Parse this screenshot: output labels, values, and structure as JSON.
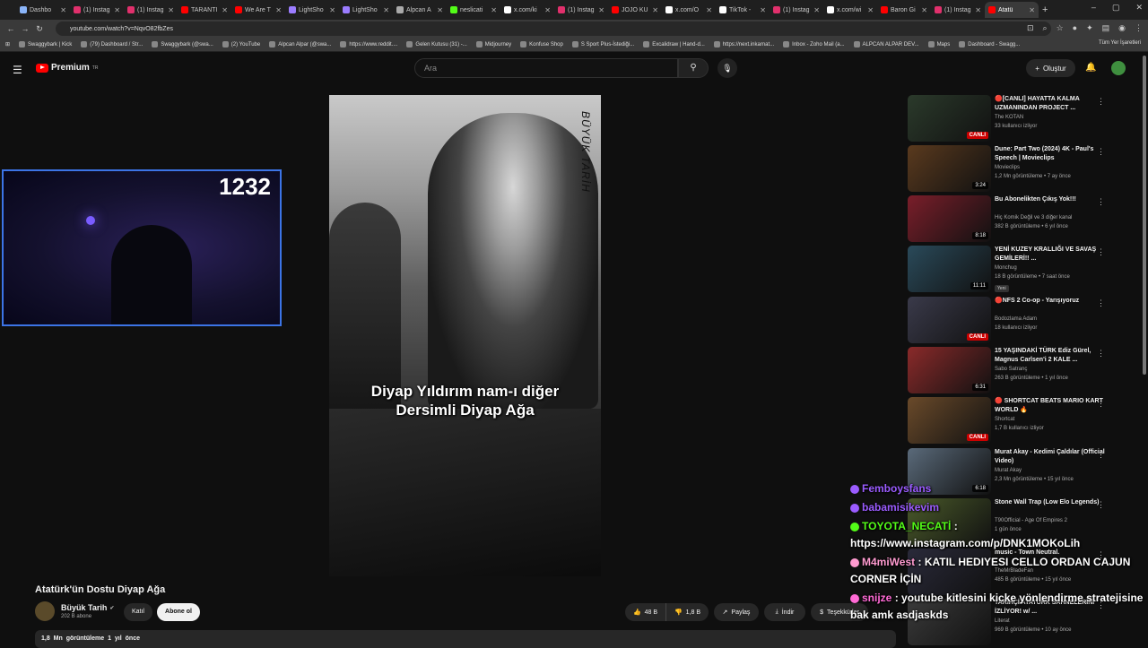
{
  "browser": {
    "tabs": [
      {
        "label": "Dashbo",
        "color": "#8ab4f8"
      },
      {
        "label": "(1) Instag",
        "color": "#e1306c"
      },
      {
        "label": "(1) Instag",
        "color": "#e1306c"
      },
      {
        "label": "TARANTI",
        "color": "#ff0000"
      },
      {
        "label": "We Are T",
        "color": "#ff0000"
      },
      {
        "label": "LightSho",
        "color": "#9b7cff"
      },
      {
        "label": "LightSho",
        "color": "#9b7cff"
      },
      {
        "label": "Alpcan A",
        "color": "#aaaaaa"
      },
      {
        "label": "neslicati",
        "color": "#53fc18"
      },
      {
        "label": "x.com/ki",
        "color": "#ffffff"
      },
      {
        "label": "(1) Instag",
        "color": "#e1306c"
      },
      {
        "label": "JOJO KU",
        "color": "#ff0000"
      },
      {
        "label": "x.com/O",
        "color": "#ffffff"
      },
      {
        "label": "TikTok - ",
        "color": "#ffffff"
      },
      {
        "label": "(1) Instag",
        "color": "#e1306c"
      },
      {
        "label": "x.com/wi",
        "color": "#ffffff"
      },
      {
        "label": "Baron Gi",
        "color": "#ff0000"
      },
      {
        "label": "(1) Instag",
        "color": "#e1306c"
      },
      {
        "label": "Atatü",
        "color": "#ff0000"
      }
    ],
    "url": "youtube.com/watch?v=NqvO82fbZes",
    "bookmarks": [
      "Swaggybark | Kick",
      "(79) Dashboard / Str...",
      "Swaggybark (@swa...",
      "(2) YouTube",
      "Alpcan Alpar (@swa...",
      "https://www.reddit....",
      "Gelen Kutusu (31) -...",
      "Midjourney",
      "Konfuse Shop",
      "S Sport Plus-İstediği...",
      "Excalidraw | Hand-d...",
      "https://next.inkarnat...",
      "Inbox - Zoho Mail (a...",
      "ALPCAN ALPAR DEV...",
      "Maps",
      "Dashboard - Swagg..."
    ],
    "all_bookmarks": "Tüm Yer İşaretleri"
  },
  "header": {
    "logo": "Premium",
    "logo_sup": "TR",
    "search_placeholder": "Ara",
    "create": "Oluştur"
  },
  "video": {
    "watermark": "BÜYÜK TARİH",
    "caption_line1": "Diyap Yıldırım nam-ı diğer",
    "caption_line2": "Dersimli Diyap Ağa",
    "title": "Atatürk'ün Dostu Diyap Ağa",
    "channel": "Büyük Tarih",
    "subs": "202 B abone",
    "join": "Katıl",
    "subscribe": "Abone ol",
    "likes": "48 B",
    "dislikes": "1,8 B",
    "share": "Paylaş",
    "download": "İndir",
    "thanks": "Teşekkürler",
    "views": "1,8 Mn görüntüleme",
    "age": "1 yıl önce"
  },
  "cam": {
    "counter": "1232"
  },
  "recs": [
    {
      "title": "🔴[CANLI] HAYATTA KALMA UZMANINDAN PROJECT ...",
      "channel": "The KOTAN",
      "meta": "33 kullanıcı izliyor",
      "badge": "CANLI",
      "live": true,
      "thumb": "#2b3a2b"
    },
    {
      "title": "Dune: Part Two (2024) 4K - Paul's Speech | Movieclips",
      "channel": "Movieclips",
      "meta": "1,2 Mn görüntüleme • 7 ay önce",
      "badge": "3:24",
      "live": false,
      "thumb": "#5a3a1e"
    },
    {
      "title": "Bu Abonelikten Çıkış Yok!!!",
      "channel": "Hiç Komik Değil ve 3 diğer kanal",
      "meta": "382 B görüntüleme • 6 yıl önce",
      "badge": "8:18",
      "live": false,
      "thumb": "#7a1e2a"
    },
    {
      "title": "YENİ KUZEY KRALLIĞI VE SAVAŞ GEMİLERİ!! ...",
      "channel": "Monchug",
      "meta": "18 B görüntüleme • 7 saat önce",
      "badge": "11:11",
      "live": false,
      "thumb": "#2a4a5a",
      "isnew": "Yeni"
    },
    {
      "title": "🔴NFS 2 Co-op - Yarışıyoruz",
      "channel": "Bodozlama Adam",
      "meta": "18 kullanıcı izliyor",
      "badge": "CANLI",
      "live": true,
      "thumb": "#3a3a4a"
    },
    {
      "title": "15 YAŞINDAKİ TÜRK Ediz Gürel, Magnus Carlsen'i 2 KALE ...",
      "channel": "Sabo Satranç",
      "meta": "263 B görüntüleme • 1 yıl önce",
      "badge": "6:31",
      "live": false,
      "thumb": "#8a2a2a"
    },
    {
      "title": "🔴 SHORTCAT BEATS MARIO KART WORLD 🔥",
      "channel": "Shortcat",
      "meta": "1,7 B kullanıcı izliyor",
      "badge": "CANLI",
      "live": true,
      "thumb": "#6a4a2a"
    },
    {
      "title": "Murat Akay - Kedimi Çaldılar (Official Video)",
      "channel": "Murat Akay",
      "meta": "2,3 Mn görüntüleme • 15 yıl önce",
      "badge": "6:18",
      "live": false,
      "thumb": "#5a6a7a"
    },
    {
      "title": "Stone Wall Trap (Low Elo Legends)",
      "channel": "T90Official - Age Of Empires 2",
      "meta": "1 gün önce",
      "badge": "",
      "live": false,
      "thumb": "#4a5a2a"
    },
    {
      "title": "music - Town Neutral.",
      "channel": "TheMrBladeFan",
      "meta": "485 B görüntüleme • 15 yıl önce",
      "badge": "",
      "live": false,
      "thumb": "#2a2a3a"
    },
    {
      "title": "TARİHÇİ ATATÜRK SAHNELERİNİ İZLİYOR! w/ ...",
      "channel": "Literat",
      "meta": "969 B görüntüleme • 10 ay önce",
      "badge": "",
      "live": false,
      "thumb": "#3a3a3a"
    }
  ],
  "chat": [
    {
      "user": "Femboysfans",
      "msg": "",
      "color": "#9b5cff"
    },
    {
      "user": "babamisikevim",
      "msg": "",
      "color": "#9b5cff"
    },
    {
      "user": "TOYOTA_NECATİ",
      "msg": ":",
      "color": "#53fc18"
    },
    {
      "user": "",
      "msg": "https://www.instagram.com/p/DNK1MOKoLih",
      "color": "#ffffff"
    },
    {
      "user": "M4miWest",
      "msg": ": KATIL HEDIYESI CELLO ORDAN CAJUN",
      "color": "#ff9bd0"
    },
    {
      "user": "",
      "msg": "CORNER İÇİN",
      "color": "#ffffff"
    },
    {
      "user": "snijze",
      "msg": ": youtube kitlesini kicke yönlendirme stratejisine",
      "color": "#ff6ad5"
    },
    {
      "user": "",
      "msg": "bak amk asdjaskds",
      "color": "#ffffff"
    }
  ]
}
